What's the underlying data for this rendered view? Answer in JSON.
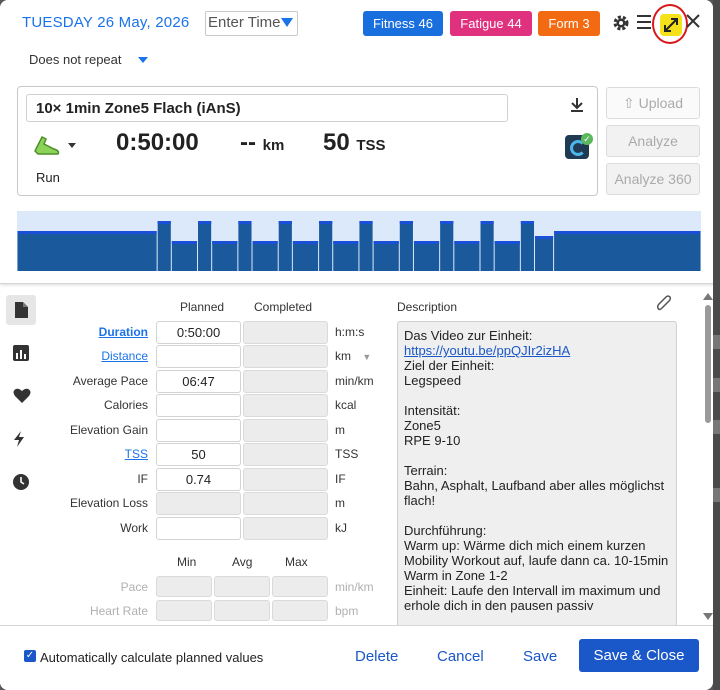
{
  "header": {
    "date": "TUESDAY 26 May, 2026",
    "time_placeholder": "Enter Time",
    "badges": {
      "fitness": "Fitness 46",
      "fatigue": "Fatigue 44",
      "form": "Form 3"
    },
    "repeat": "Does not repeat"
  },
  "workout": {
    "title": "10× 1min Zone5 Flach (iAnS)",
    "duration": "0:50:00",
    "distance": "--",
    "distance_unit": "km",
    "tss": "50",
    "tss_unit": "TSS",
    "sport": "Run"
  },
  "actions": {
    "upload": "Upload",
    "analyze": "Analyze",
    "analyze360": "Analyze 360"
  },
  "colors": {
    "accent": "#1a57c8",
    "fitness": "#1a6fdf",
    "fatigue": "#e0317e",
    "form": "#f26b12",
    "chart_bar": "#1a5a9c",
    "chart_top": "#1a4fd8",
    "chart_bg": "#dbe9fb"
  },
  "chart_data": {
    "type": "bar",
    "unit": "intensity zone",
    "segments": [
      {
        "start": 0.0,
        "end": 0.2049,
        "zone": 4
      },
      {
        "start": 0.2049,
        "end": 0.2256,
        "zone": 5
      },
      {
        "start": 0.2256,
        "end": 0.2639,
        "zone": 3
      },
      {
        "start": 0.2639,
        "end": 0.2846,
        "zone": 5
      },
      {
        "start": 0.2846,
        "end": 0.3229,
        "zone": 3
      },
      {
        "start": 0.3229,
        "end": 0.3436,
        "zone": 5
      },
      {
        "start": 0.3436,
        "end": 0.3819,
        "zone": 3
      },
      {
        "start": 0.3819,
        "end": 0.4026,
        "zone": 5
      },
      {
        "start": 0.4026,
        "end": 0.4409,
        "zone": 3
      },
      {
        "start": 0.4409,
        "end": 0.4616,
        "zone": 5
      },
      {
        "start": 0.4616,
        "end": 0.4999,
        "zone": 3
      },
      {
        "start": 0.4999,
        "end": 0.5206,
        "zone": 5
      },
      {
        "start": 0.5206,
        "end": 0.5589,
        "zone": 3
      },
      {
        "start": 0.5589,
        "end": 0.5796,
        "zone": 5
      },
      {
        "start": 0.5796,
        "end": 0.6179,
        "zone": 3
      },
      {
        "start": 0.6179,
        "end": 0.6386,
        "zone": 5
      },
      {
        "start": 0.6386,
        "end": 0.6769,
        "zone": 3
      },
      {
        "start": 0.6769,
        "end": 0.6976,
        "zone": 5
      },
      {
        "start": 0.6976,
        "end": 0.7359,
        "zone": 3
      },
      {
        "start": 0.7359,
        "end": 0.7566,
        "zone": 5
      },
      {
        "start": 0.7566,
        "end": 0.7845,
        "zone": 3.5
      },
      {
        "start": 0.7845,
        "end": 1.0,
        "zone": 4
      }
    ],
    "max_zone": 6
  },
  "form": {
    "col_planned": "Planned",
    "col_completed": "Completed",
    "rows": [
      {
        "label": "Duration",
        "planned": "0:50:00",
        "completed": "",
        "unit": "h:m:s"
      },
      {
        "label": "Distance",
        "planned": "",
        "completed": "",
        "unit": "km"
      },
      {
        "label": "Average Pace",
        "planned": "06:47",
        "completed": "",
        "unit": "min/km"
      },
      {
        "label": "Calories",
        "planned": "",
        "completed": "",
        "unit": "kcal"
      },
      {
        "label": "Elevation Gain",
        "planned": "",
        "completed": "",
        "unit": "m"
      },
      {
        "label": "TSS",
        "planned": "50",
        "completed": "",
        "unit": "TSS"
      },
      {
        "label": "IF",
        "planned": "0.74",
        "completed": "",
        "unit": "IF"
      },
      {
        "label": "Elevation Loss",
        "planned": "",
        "completed": "",
        "unit": "m"
      },
      {
        "label": "Work",
        "planned": "",
        "completed": "",
        "unit": "kJ"
      }
    ],
    "minmax_headers": {
      "min": "Min",
      "avg": "Avg",
      "max": "Max"
    },
    "minmax_rows": [
      {
        "label": "Pace",
        "unit": "min/km"
      },
      {
        "label": "Heart Rate",
        "unit": "bpm"
      }
    ]
  },
  "description": {
    "label": "Description",
    "line1": "Das Video zur Einheit:",
    "url": "https://youtu.be/ppQJIr2izHA",
    "body": "\nZiel der Einheit:\nLegspeed\n\nIntensität:\nZone5\nRPE 9-10\n\nTerrain:\nBahn, Asphalt, Laufband aber alles möglichst flach!\n\nDurchführung:\nWarm up: Wärme dich mich einem kurzen Mobility Workout auf, laufe dann ca. 10-15min Warm in Zone 1-2\nEinheit: Laufe den Intervall im maximum und erhole dich in den pausen passiv"
  },
  "footer": {
    "auto_calc": "Automatically calculate planned values",
    "delete": "Delete",
    "cancel": "Cancel",
    "save": "Save",
    "save_close": "Save & Close"
  }
}
